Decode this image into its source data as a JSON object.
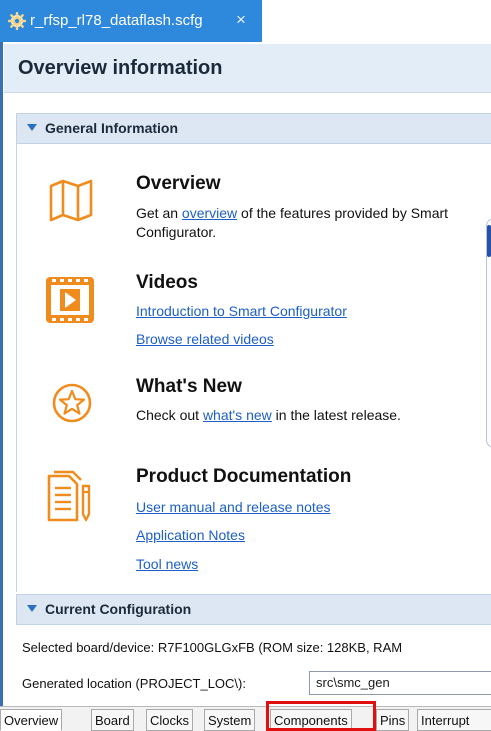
{
  "editor_tab": {
    "title": "r_rfsp_rl78_dataflash.scfg",
    "close_glyph": "×",
    "icon": "gear-icon"
  },
  "page": {
    "title": "Overview information"
  },
  "general": {
    "header": "General Information",
    "items": [
      {
        "icon": "map-icon",
        "title": "Overview",
        "text_before": "Get an ",
        "link": "overview",
        "text_after": " of the features provided by Smart Configurator."
      },
      {
        "icon": "video-icon",
        "title": "Videos",
        "links": [
          "Introduction to Smart Configurator",
          "Browse related videos"
        ]
      },
      {
        "icon": "star-icon",
        "title": "What's New",
        "text_before": "Check out ",
        "link": "what's new",
        "text_after": " in the latest release."
      },
      {
        "icon": "document-icon",
        "title": "Product Documentation",
        "links": [
          "User manual and release notes",
          "Application Notes",
          "Tool news"
        ]
      }
    ]
  },
  "current_config": {
    "header": "Current Configuration",
    "board_label": "Selected board/device:",
    "board_value": "R7F100GLGxFB (ROM size: 128KB, RAM",
    "location_label": "Generated location (PROJECT_LOC\\):",
    "location_value": "src\\smc_gen"
  },
  "bottom_tabs": [
    "Overview",
    "Board",
    "Clocks",
    "System",
    "Components",
    "Pins",
    "Interrupt"
  ],
  "colors": {
    "accent": "#2e88dc",
    "icon_orange": "#f08c1e",
    "link": "#1d5fc4",
    "highlight": "#e01010"
  }
}
